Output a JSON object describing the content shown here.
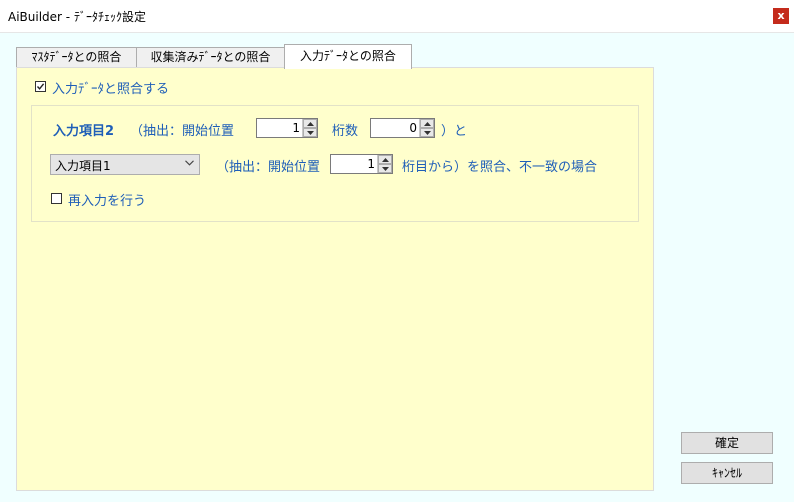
{
  "window": {
    "title": "AiBuilder - ﾃﾞｰﾀﾁｪｯｸ設定",
    "close_label": "x"
  },
  "tabs": [
    {
      "label": "ﾏｽﾀﾃﾞｰﾀとの照合",
      "active": false
    },
    {
      "label": "収集済みﾃﾞｰﾀとの照合",
      "active": false
    },
    {
      "label": "入力ﾃﾞｰﾀとの照合",
      "active": true
    }
  ],
  "panel": {
    "match_checkbox": {
      "label": "入力ﾃﾞｰﾀと照合する",
      "checked": true
    },
    "row1": {
      "item_label": "入力項目2",
      "extract_start_label": "（抽出：開始位置",
      "start_value": "1",
      "digits_label": "桁数",
      "digits_value": "0",
      "suffix": "）と"
    },
    "row2": {
      "selected_item": "入力項目1",
      "extract_start_label": "（抽出：開始位置",
      "start_value": "1",
      "suffix": "桁目から）を照合、不一致の場合"
    },
    "reinput_checkbox": {
      "label": "再入力を行う",
      "checked": false
    }
  },
  "buttons": {
    "confirm": "確定",
    "cancel": "ｷｬﾝｾﾙ"
  },
  "colors": {
    "panel_background": "#ffffcc",
    "label_blue": "#1e5eb8",
    "window_background": "#f0ffff"
  }
}
